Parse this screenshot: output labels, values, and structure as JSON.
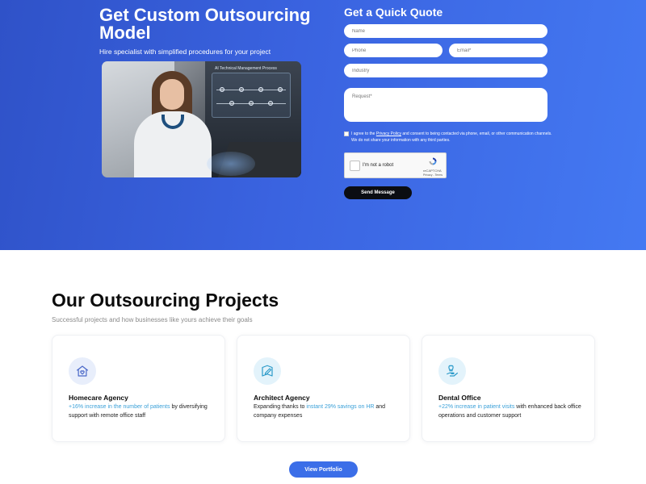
{
  "hero": {
    "title": "Get Custom Outsourcing Model",
    "subtitle": "Hire specialist with simplified procedures for your project",
    "image_overlay_text": "AI Technical Management Process"
  },
  "quote_form": {
    "title": "Get a Quick Quote",
    "name_placeholder": "Name",
    "phone_placeholder": "Phone",
    "email_placeholder": "Email*",
    "industry_placeholder": "Industry",
    "request_placeholder": "Request*",
    "consent_prefix": "I agree to the ",
    "consent_link": "Privacy Policy",
    "consent_suffix": " and consent to being contacted via phone, email, or other communication channels. We do not share your information with any third parties.",
    "recaptcha_label": "I'm not a robot",
    "recaptcha_brand": "reCAPTCHA",
    "recaptcha_terms": "Privacy - Terms",
    "send_label": "Send Message"
  },
  "projects": {
    "title": "Our Outsourcing Projects",
    "subtitle": "Successful projects and how businesses like yours achieve their goals",
    "cards": [
      {
        "icon": "home-heart-icon",
        "title": "Homecare Agency",
        "highlight": "+16% increase in the number of patients",
        "rest": " by diversifying support with remote office staff",
        "lead": ""
      },
      {
        "icon": "blueprint-pen-icon",
        "title": "Architect Agency",
        "lead": "Expanding thanks to ",
        "highlight": "instant 29% savings on HR",
        "rest": " and company expenses"
      },
      {
        "icon": "tooth-hand-icon",
        "title": "Dental Office",
        "lead": "",
        "highlight": "+22% increase in patient visits",
        "rest": " with enhanced back office operations and customer support"
      }
    ],
    "view_portfolio_label": "View Portfolio"
  },
  "colors": {
    "hero_gradient_start": "#2f52c8",
    "hero_gradient_end": "#4479f2",
    "accent_blue": "#3b6ee8",
    "highlight_text": "#3aa0d8",
    "icon_bg_1": "#e8eefb",
    "icon_bg_2": "#e3f3fb",
    "icon_bg_3": "#e3f3fb",
    "button_dark": "#0b0d12"
  }
}
